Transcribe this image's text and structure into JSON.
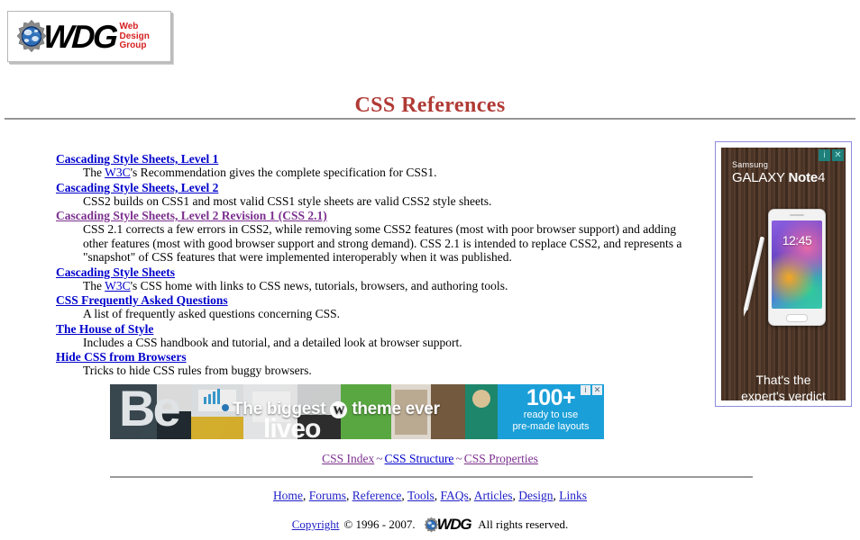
{
  "logo": {
    "wordmark": "WDG",
    "tagline_line1": "Web",
    "tagline_line2": "Design",
    "tagline_line3": "Group"
  },
  "page_title": "CSS References",
  "references": [
    {
      "link": "Cascading Style Sheets, Level 1",
      "visited": false,
      "desc_before": "The ",
      "desc_link": "W3C",
      "desc_after": "'s Recommendation gives the complete specification for CSS1."
    },
    {
      "link": "Cascading Style Sheets, Level 2",
      "visited": false,
      "desc_before": "CSS2 builds on CSS1 and most valid CSS1 style sheets are valid CSS2 style sheets.",
      "desc_link": "",
      "desc_after": ""
    },
    {
      "link": "Cascading Style Sheets, Level 2 Revision 1 (CSS 2.1)",
      "visited": true,
      "desc_before": "CSS 2.1 corrects a few errors in CSS2, while removing some CSS2 features (most with poor browser support) and adding other features (most with good browser support and strong demand). CSS 2.1 is intended to replace CSS2, and represents a \"snapshot\" of CSS features that were implemented interoperably when it was published.",
      "desc_link": "",
      "desc_after": ""
    },
    {
      "link": "Cascading Style Sheets",
      "visited": false,
      "desc_before": "The ",
      "desc_link": "W3C",
      "desc_after": "'s CSS home with links to CSS news, tutorials, browsers, and authoring tools."
    },
    {
      "link": "CSS Frequently Asked Questions",
      "visited": false,
      "desc_before": "A list of frequently asked questions concerning CSS.",
      "desc_link": "",
      "desc_after": ""
    },
    {
      "link": "The House of Style",
      "visited": false,
      "desc_before": "Includes a CSS handbook and tutorial, and a detailed look at browser support.",
      "desc_link": "",
      "desc_after": ""
    },
    {
      "link": "Hide CSS from Browsers",
      "visited": false,
      "desc_before": "Tricks to hide CSS rules from buggy browsers.",
      "desc_link": "",
      "desc_after": ""
    }
  ],
  "side_ad": {
    "brand_small": "Samsung",
    "brand_large_1": "GALAXY",
    "brand_large_2": "Note",
    "brand_large_3": "4",
    "phone_time": "12:45",
    "tagline_line1": "That's the",
    "tagline_line2": "expert's verdict",
    "info_badge": "i",
    "close_badge": "✕"
  },
  "banner_ad": {
    "be_logo": "Be",
    "headline_before": "The biggest",
    "wordpress_mark": "W",
    "headline_after": "theme ever",
    "liveo": "liveo",
    "right_big": "100+",
    "right_sub_1": "ready to use",
    "right_sub_2": "pre-made layouts",
    "info_badge": "i",
    "close_badge": "✕"
  },
  "subnav": {
    "items": [
      {
        "label": "CSS Index",
        "visited": true
      },
      {
        "label": "CSS Structure",
        "visited": false
      },
      {
        "label": "CSS Properties",
        "visited": true
      }
    ],
    "separator": "~"
  },
  "mainnav": {
    "items": [
      "Home",
      "Forums",
      "Reference",
      "Tools",
      "FAQs",
      "Articles",
      "Design",
      "Links"
    ],
    "separator": ", "
  },
  "footer": {
    "copyright_link": "Copyright",
    "copyright_years": "© 1996 - 2007.",
    "wdg_mark": "WDG",
    "rights": "All rights reserved."
  },
  "colors": {
    "title": "#b03a35",
    "link": "#0000cc",
    "visited_link": "#7b2f8e",
    "logo_tagline": "#d62121",
    "banner_accent": "#1b9fd8",
    "ad_badge": "#1f7f7a"
  }
}
